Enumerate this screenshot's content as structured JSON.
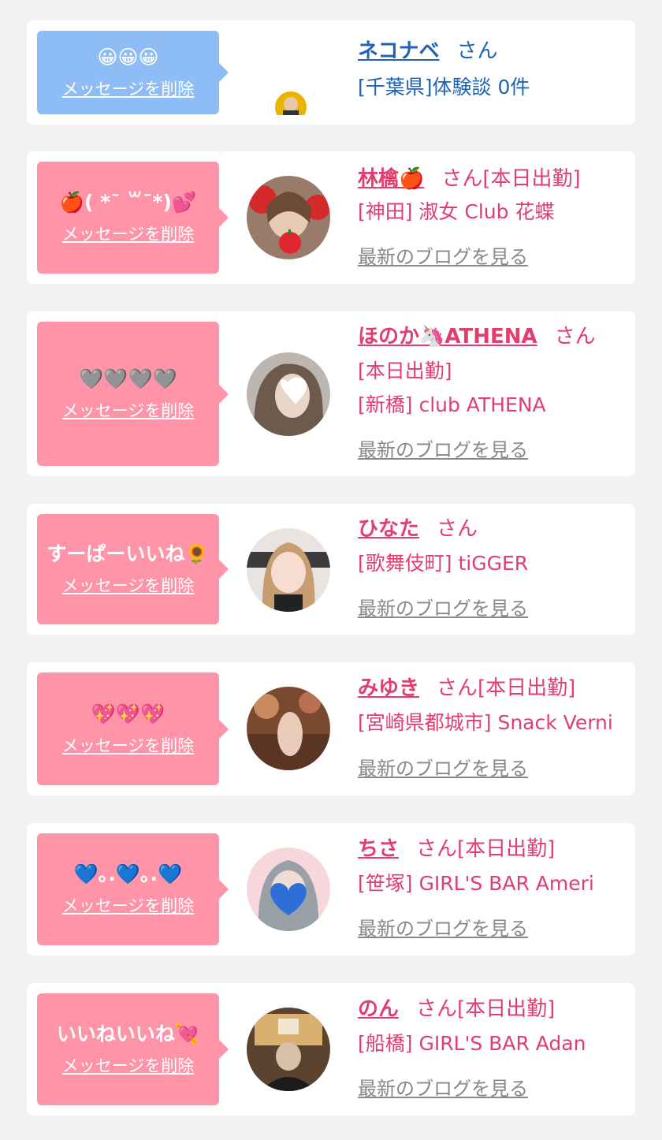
{
  "delete_label": "メッセージを削除",
  "blog_label": "最新のブログを見る",
  "san": "さん",
  "cards": [
    {
      "message": "😀😀😀",
      "name": "ネコナベ",
      "line1": "[千葉県]体験談 0件"
    },
    {
      "message": "🍎( *ˉ ꒳ˉ*)💕",
      "name": "林檎🍎",
      "badge": "[本日出勤]",
      "line1": "[神田] 淑女 Club 花蝶"
    },
    {
      "message": "🩶🩶🩶🩶",
      "name": "ほのか🦄ATHENA",
      "line1": "[本日出勤]",
      "line2": "[新橋] club ATHENA"
    },
    {
      "message": "すーぱーいいね🌻",
      "name": "ひなた",
      "line1": "[歌舞伎町] tiGGER"
    },
    {
      "message": "💖💖💖",
      "name": "みゆき",
      "badge": "[本日出勤]",
      "line1": "[宮崎県都城市] Snack Verni"
    },
    {
      "message": "💙｡.💙｡.💙",
      "name": "ちさ",
      "badge": "[本日出勤]",
      "line1": "[笹塚] GIRL'S BAR Ameri"
    },
    {
      "message": "いいねいいね💘",
      "name": "のん",
      "badge": "[本日出勤]",
      "line1": "[船橋] GIRL'S BAR Adan"
    }
  ]
}
